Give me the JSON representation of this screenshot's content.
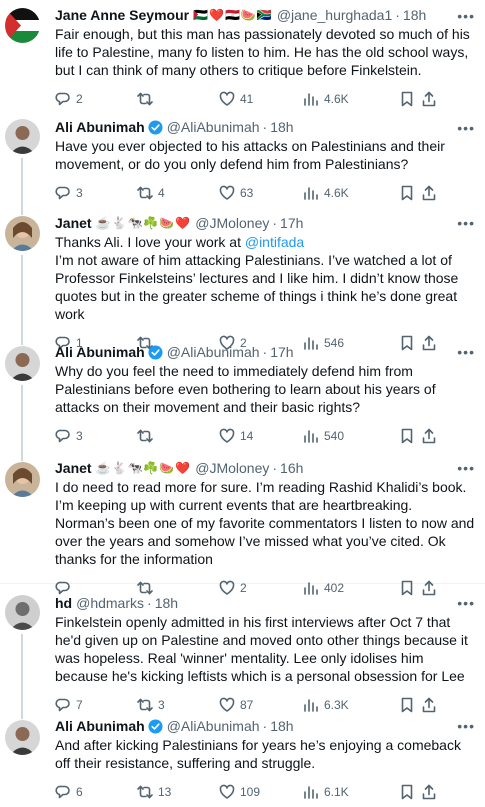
{
  "colors": {
    "accent": "#1d9bf0",
    "secondary_text": "#536471",
    "separator": "#eff3f4",
    "thread_line": "#cfd9de"
  },
  "tweets": [
    {
      "name": "Jane Anne Seymour",
      "emojis": "🇵🇸❤️🇪🇬🍉🇿🇦",
      "handle": "@jane_hurghada1",
      "time": "18h",
      "text": "Fair enough, but this man has passionately devoted so much of his life to Palestine, many fo listen to him. He has the old school ways, but I can think of many others to critique before Finkelstein.",
      "replies": "2",
      "reposts": "",
      "likes": "41",
      "views": "4.6K"
    },
    {
      "name": "Ali Abunimah",
      "verified": true,
      "handle": "@AliAbunimah",
      "time": "18h",
      "text": "Have you ever objected to his attacks on Palestinians and their movement, or do you only defend him from Palestinians?",
      "replies": "3",
      "reposts": "4",
      "likes": "63",
      "views": "4.6K"
    },
    {
      "name": "Janet",
      "emojis": "☕🐇🐄☘️🍉❤️",
      "handle": "@JMoloney",
      "time": "17h",
      "text_before": "Thanks Ali. I love your work at ",
      "mention": "@intifada",
      "text_after": "\nI’m not aware of him attacking Palestinians. I’ve watched a lot of Professor Finkelsteins’ lectures and I like him. I didn’t know those quotes but in the greater scheme of things i think he’s done great work",
      "replies": "1",
      "reposts": "",
      "likes": "2",
      "views": "546"
    },
    {
      "name": "Ali Abunimah",
      "verified": true,
      "handle": "@AliAbunimah",
      "time": "17h",
      "text": "Why do you feel the need to immediately defend him from Palestinians before even bothering to learn about his years of attacks on their movement and their basic rights?",
      "replies": "3",
      "reposts": "",
      "likes": "14",
      "views": "540"
    },
    {
      "name": "Janet",
      "emojis": "☕🐇🐄☘️🍉❤️",
      "handle": "@JMoloney",
      "time": "16h",
      "text": "I do need to read more for sure. I’m reading Rashid Khalidi’s book. I’m keeping up with current events that are heartbreaking. Norman’s been one of my favorite commentators I listen to now and over the years and somehow I’ve missed what you’ve cited. Ok thanks for the information",
      "replies": "",
      "reposts": "",
      "likes": "2",
      "views": "402"
    },
    {
      "name": "hd",
      "handle": "@hdmarks",
      "time": "18h",
      "text": "Finkelstein openly admitted in his first interviews after Oct 7 that he'd given up on Palestine and moved onto other things because it was hopeless. Real 'winner' mentality. Lee only idolises him because he's kicking leftists which is a personal obsession for Lee",
      "replies": "7",
      "reposts": "3",
      "likes": "87",
      "views": "6.3K"
    },
    {
      "name": "Ali Abunimah",
      "verified": true,
      "handle": "@AliAbunimah",
      "time": "18h",
      "text": "And after kicking Palestinians for years he’s enjoying a comeback off their resistance, suffering and struggle.",
      "replies": "6",
      "reposts": "13",
      "likes": "109",
      "views": "6.1K"
    }
  ]
}
